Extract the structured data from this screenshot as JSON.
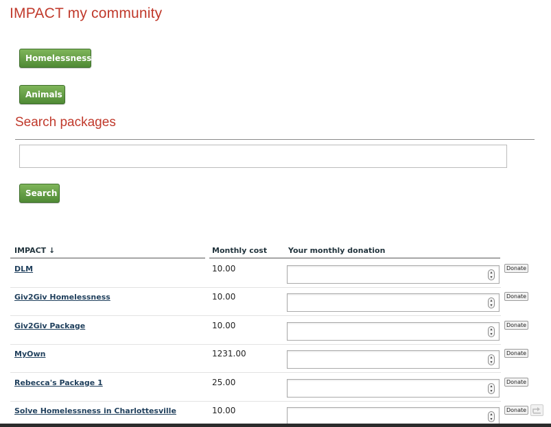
{
  "header": {
    "title": "IMPACT my community"
  },
  "categories": [
    "Homelessness",
    "Animals"
  ],
  "search": {
    "heading": "Search packages",
    "input_value": "",
    "button_label": "Search"
  },
  "table": {
    "headers": {
      "impact": "IMPACT ↓",
      "monthly_cost": "Monthly cost",
      "your_donation": "Your monthly donation"
    },
    "donate_label": "Donate",
    "rows": [
      {
        "name": "DLM",
        "cost": "10.00",
        "donation": ""
      },
      {
        "name": "Giv2Giv Homelessness",
        "cost": "10.00",
        "donation": ""
      },
      {
        "name": "Giv2Giv Package",
        "cost": "10.00",
        "donation": ""
      },
      {
        "name": "MyOwn",
        "cost": "1231.00",
        "donation": ""
      },
      {
        "name": "Rebecca's Package 1",
        "cost": "25.00",
        "donation": ""
      },
      {
        "name": "Solve Homelessness in Charlottesville",
        "cost": "10.00",
        "donation": ""
      }
    ]
  },
  "icons": {
    "spinner": "number-spinner-icon",
    "corner": "share-icon"
  },
  "colors": {
    "heading": "#c0392b",
    "button_green": "#5e9a3e",
    "link": "#1f3f5c"
  }
}
